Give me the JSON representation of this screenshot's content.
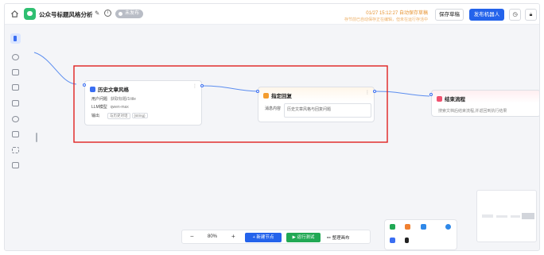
{
  "header": {
    "title": "公众号标题风格分析",
    "status": "未发布",
    "save_time": "01/27 15:12:27 自动保存草稿",
    "save_hint": "存节前已自动保存正在编辑，但未在运行存活中",
    "save_draft_label": "保存草稿",
    "publish_label": "发布机器人"
  },
  "nodes": {
    "history": {
      "title": "历史文章风格",
      "rows": [
        {
          "label": "用户问题",
          "value": "获取标题/1title"
        },
        {
          "label": "LLM模型",
          "value": "qwen-max"
        },
        {
          "label": "输出",
          "value": "",
          "tags": [
            "与历史对话",
            "(string)"
          ]
        }
      ]
    },
    "reply": {
      "title": "指定回复",
      "field_label": "消息内容",
      "field_value": "历史文章风格与回复问题"
    },
    "end": {
      "title": "结束流程",
      "desc": "搜索文档后结束流程,并返回到执行结果"
    }
  },
  "bottom": {
    "zoom": "80%",
    "minus": "−",
    "plus": "+",
    "add_node_label": "+ 新建节点",
    "test_label": "▶ 运行测试",
    "tidy_label": "整理画布"
  },
  "colors": {
    "accent": "#2463eb",
    "run": "#21a854",
    "warning": "#e79433",
    "highlight": "#e02020",
    "reply_icon": "#f39b2c",
    "end_icon": "#f0506e"
  }
}
